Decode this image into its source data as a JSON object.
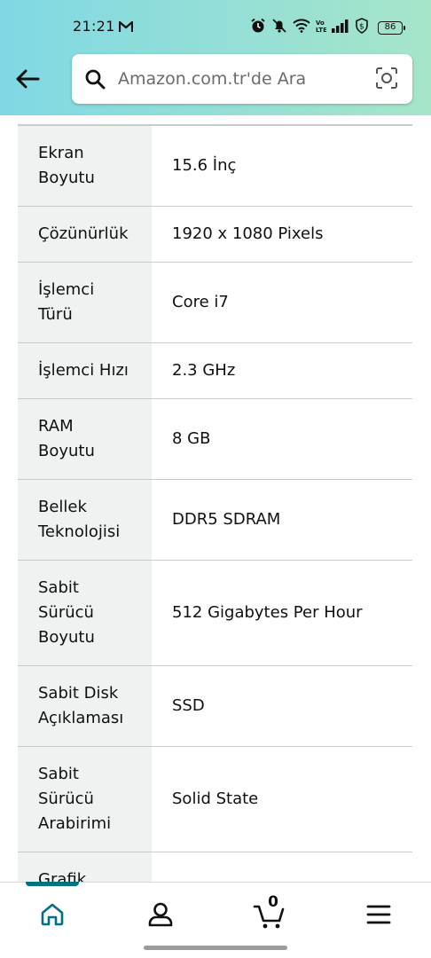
{
  "status_bar": {
    "time": "21:21",
    "battery": "86"
  },
  "header": {
    "search_placeholder": "Amazon.com.tr'de Ara"
  },
  "specs": [
    {
      "label": "",
      "value": ""
    },
    {
      "label": "Ekran\nBoyutu",
      "value": "15.6 İnç"
    },
    {
      "label": "Çözünürlük",
      "value": "1920 x 1080 Pixels"
    },
    {
      "label": "İşlemci\nTürü",
      "value": "Core i7"
    },
    {
      "label": "İşlemci Hızı",
      "value": "2.3 GHz"
    },
    {
      "label": "RAM\nBoyutu",
      "value": "8 GB"
    },
    {
      "label": "Bellek\nTeknolojisi",
      "value": "DDR5 SDRAM"
    },
    {
      "label": "Sabit\nSürücü\nBoyutu",
      "value": "512 Gigabytes Per Hour"
    },
    {
      "label": "Sabit Disk\nAçıklaması",
      "value": "SSD"
    },
    {
      "label": "Sabit\nSürücü\nArabirimi",
      "value": "Solid State"
    },
    {
      "label": "Grafik",
      "value": ""
    }
  ],
  "bottom_nav": {
    "cart_count": "0",
    "items": [
      "home-icon",
      "account-icon",
      "cart-icon",
      "menu-icon"
    ],
    "active_color": "#007185"
  }
}
